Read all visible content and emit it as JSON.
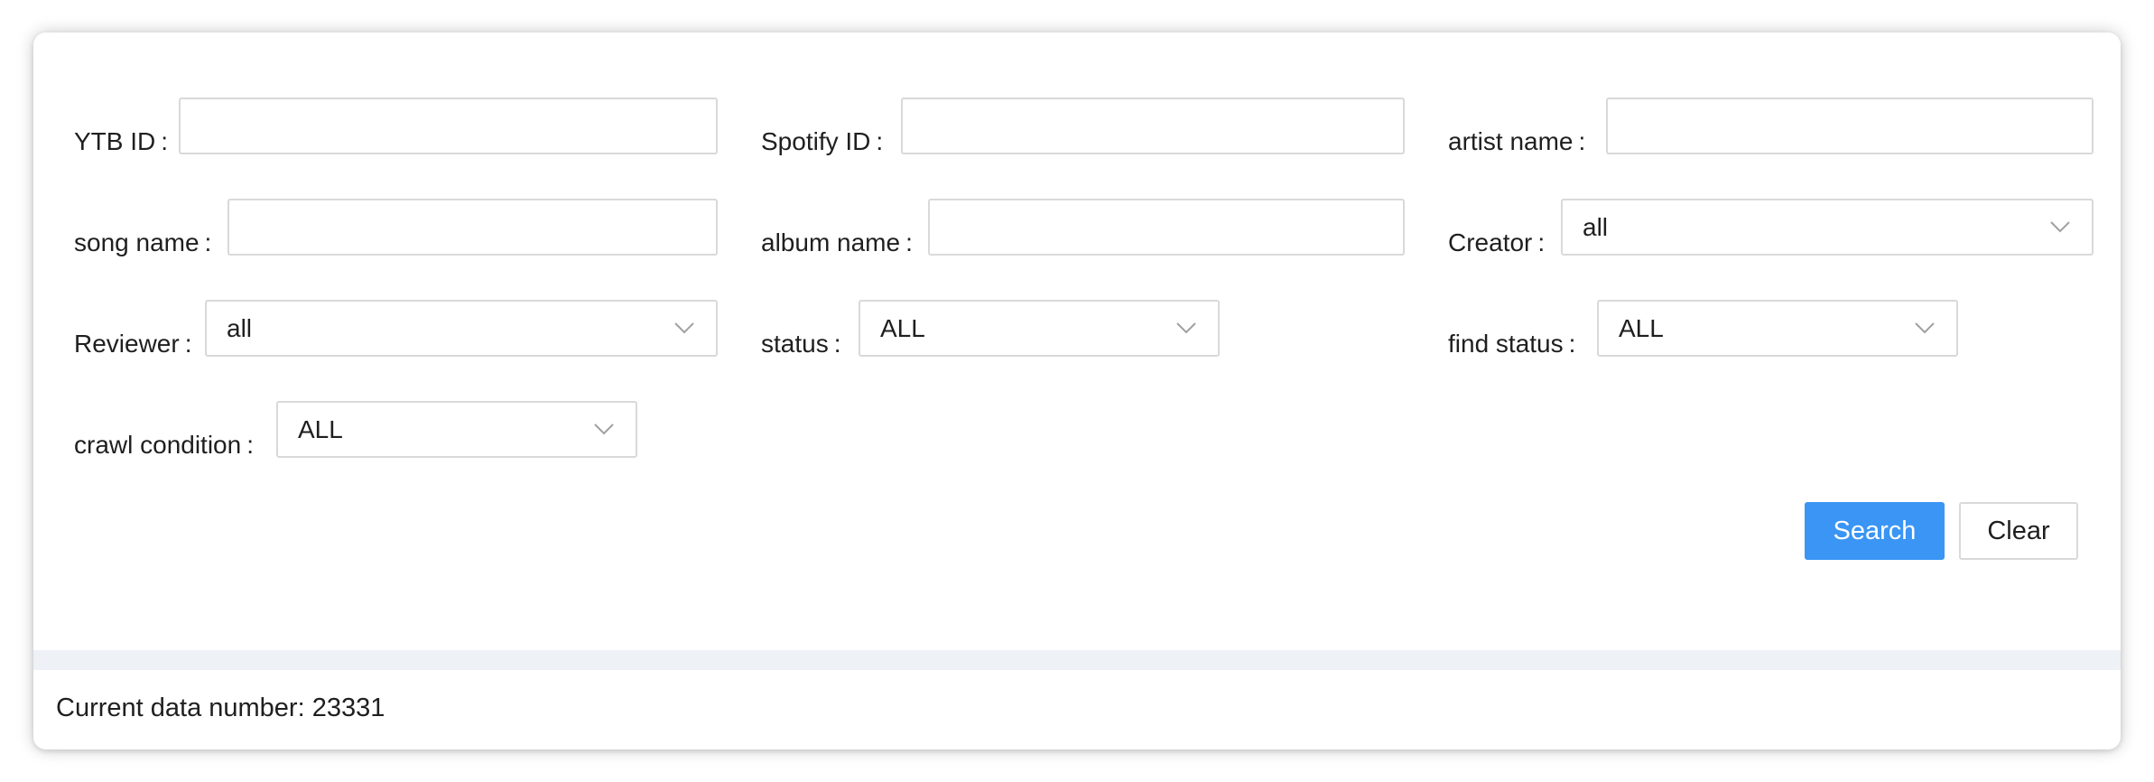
{
  "filters": {
    "ytb_id": {
      "label": "YTB ID",
      "value": ""
    },
    "spotify_id": {
      "label": "Spotify ID",
      "value": ""
    },
    "artist_name": {
      "label": "artist name",
      "value": ""
    },
    "song_name": {
      "label": "song name",
      "value": ""
    },
    "album_name": {
      "label": "album name",
      "value": ""
    },
    "creator": {
      "label": "Creator",
      "selected": "all"
    },
    "reviewer": {
      "label": "Reviewer",
      "selected": "all"
    },
    "status": {
      "label": "status",
      "selected": "ALL"
    },
    "find_status": {
      "label": "find status",
      "selected": "ALL"
    },
    "crawl_condition": {
      "label": "crawl condition",
      "selected": "ALL"
    },
    "colon": ":"
  },
  "actions": {
    "search_label": "Search",
    "clear_label": "Clear"
  },
  "results": {
    "count_text": "Current data number: 23331"
  },
  "icons": {
    "select_arrow": "chevron-down-icon"
  },
  "colors": {
    "primary": "#3a95f4",
    "border": "#d9d9d9",
    "band": "#eef2f6"
  }
}
